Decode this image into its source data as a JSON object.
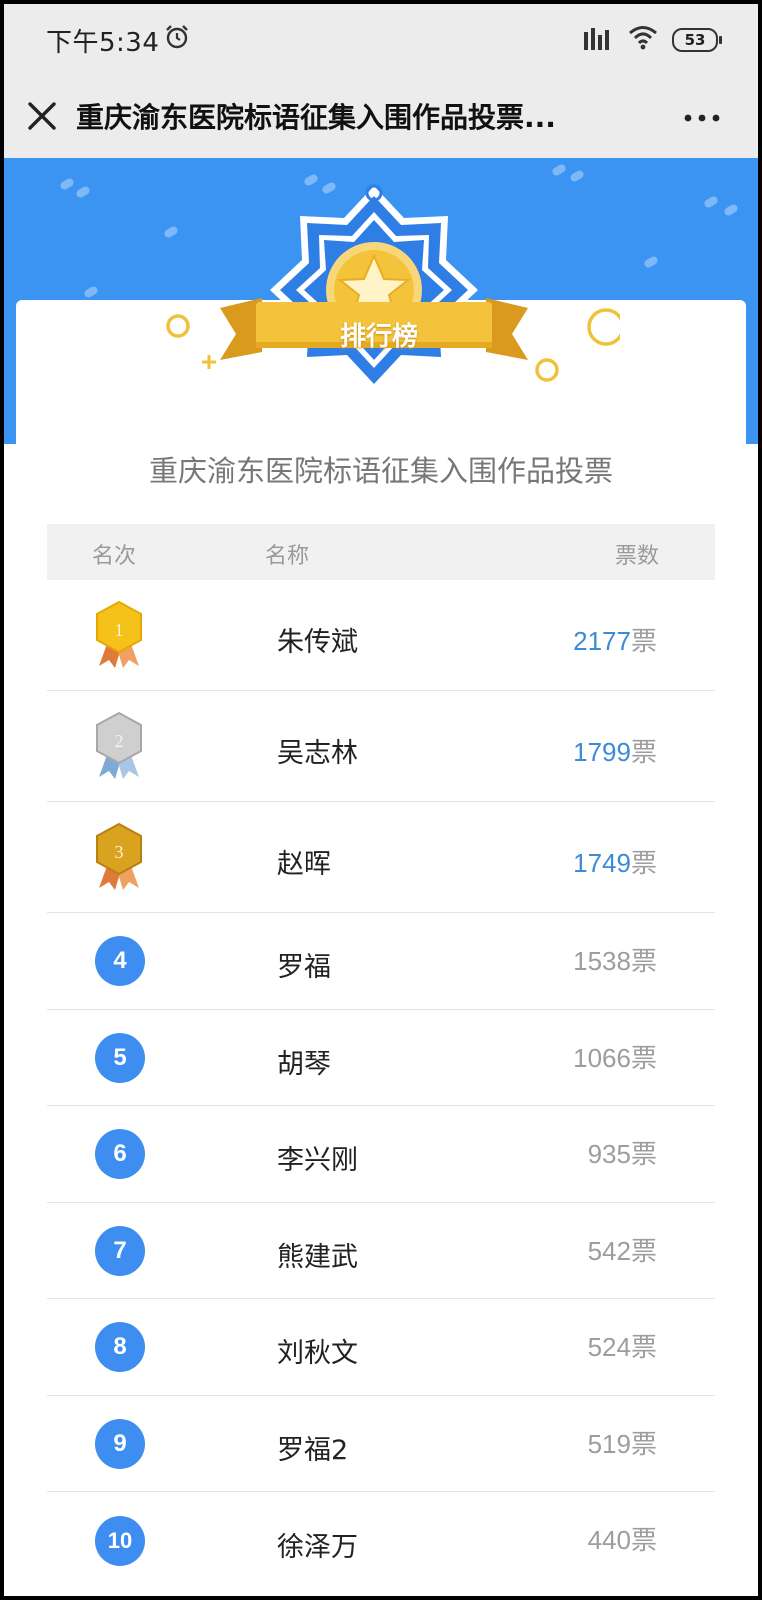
{
  "status_bar": {
    "time": "下午5:34",
    "battery": "53",
    "icons": [
      "alarm-icon",
      "signal-icon",
      "wifi-icon",
      "battery-icon"
    ]
  },
  "title_bar": {
    "title": "重庆渝东医院标语征集入围作品投票...",
    "icons": [
      "close-icon",
      "more-icon"
    ]
  },
  "banner": {
    "badge_label": "排行榜",
    "colors": {
      "banner_blue": "#3b93f2",
      "ribbon_gold": "#f3c43b",
      "badge_blue": "#2f7ee6"
    }
  },
  "main": {
    "subtitle": "重庆渝东医院标语征集入围作品投票",
    "table_header": {
      "rank": "名次",
      "name": "名称",
      "votes": "票数"
    },
    "rows": [
      {
        "rank": "1",
        "name": "朱传斌",
        "votes": "2177",
        "unit": "票",
        "medal": "gold"
      },
      {
        "rank": "2",
        "name": "吴志林",
        "votes": "1799",
        "unit": "票",
        "medal": "silver"
      },
      {
        "rank": "3",
        "name": "赵晖",
        "votes": "1749",
        "unit": "票",
        "medal": "bronze"
      },
      {
        "rank": "4",
        "name": "罗福",
        "votes": "1538",
        "unit": "票"
      },
      {
        "rank": "5",
        "name": "胡琴",
        "votes": "1066",
        "unit": "票"
      },
      {
        "rank": "6",
        "name": "李兴刚",
        "votes": "935",
        "unit": "票"
      },
      {
        "rank": "7",
        "name": "熊建武",
        "votes": "542",
        "unit": "票"
      },
      {
        "rank": "8",
        "name": "刘秋文",
        "votes": "524",
        "unit": "票"
      },
      {
        "rank": "9",
        "name": "罗福2",
        "votes": "519",
        "unit": "票"
      },
      {
        "rank": "10",
        "name": "徐泽万",
        "votes": "440",
        "unit": "票"
      }
    ],
    "colors": {
      "rank_circle": "#3d8ef0",
      "top_votes": "#3d8ad6",
      "votes": "#9d9d9d"
    }
  }
}
